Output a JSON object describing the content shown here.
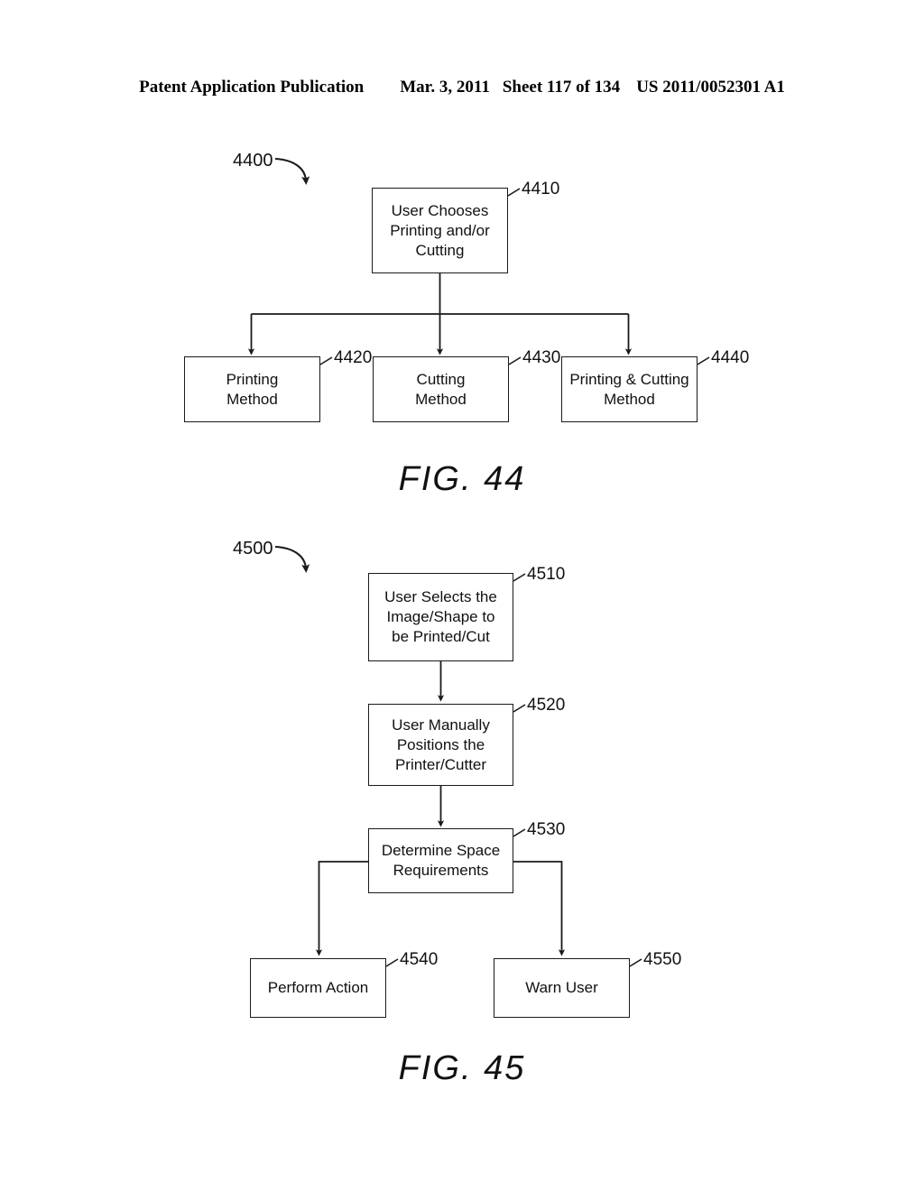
{
  "header": {
    "publication": "Patent Application Publication",
    "date": "Mar. 3, 2011",
    "sheet": "Sheet 117 of 134",
    "document_number": "US 2011/0052301 A1"
  },
  "figures": [
    {
      "id": "fig-44",
      "caption": "FIG. 44",
      "flow_ref": "4400",
      "boxes": [
        {
          "ref": "4410",
          "text": "User Chooses\nPrinting and/or\nCutting"
        },
        {
          "ref": "4420",
          "text": "Printing\nMethod"
        },
        {
          "ref": "4430",
          "text": "Cutting\nMethod"
        },
        {
          "ref": "4440",
          "text": "Printing & Cutting\nMethod"
        }
      ]
    },
    {
      "id": "fig-45",
      "caption": "FIG. 45",
      "flow_ref": "4500",
      "boxes": [
        {
          "ref": "4510",
          "text": "User Selects the\nImage/Shape to\nbe Printed/Cut"
        },
        {
          "ref": "4520",
          "text": "User  Manually\nPositions the\nPrinter/Cutter"
        },
        {
          "ref": "4530",
          "text": "Determine Space\nRequirements"
        },
        {
          "ref": "4540",
          "text": "Perform Action"
        },
        {
          "ref": "4550",
          "text": "Warn User"
        }
      ]
    }
  ],
  "colors": {
    "ink": "#111111",
    "line": "#1a1a1a",
    "paper": "#ffffff"
  }
}
